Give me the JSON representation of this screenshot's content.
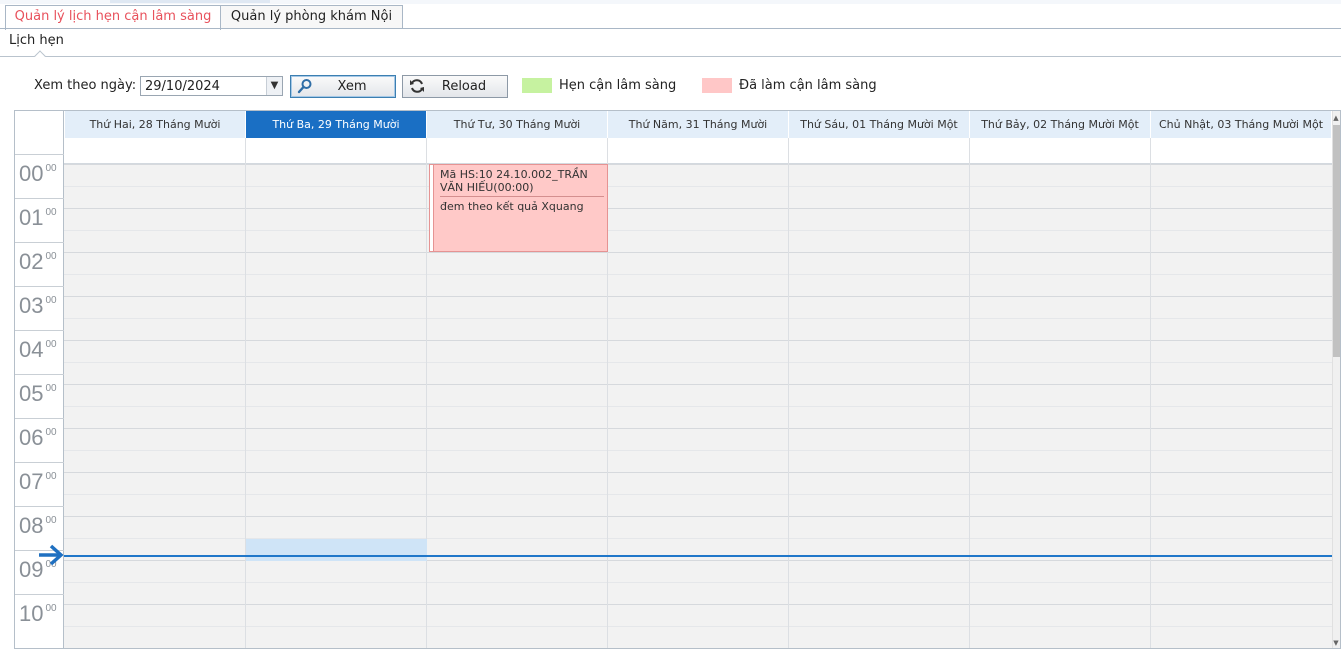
{
  "tabs": [
    {
      "label": "Quản lý lịch hẹn cận lâm sàng",
      "active": true
    },
    {
      "label": "Quản lý phòng khám Nội",
      "active": false
    }
  ],
  "subtab": {
    "label": "Lịch hẹn"
  },
  "toolbar": {
    "date_label": "Xem theo ngày:",
    "date_value": "29/10/2024",
    "view_button": "Xem",
    "reload_button": "Reload"
  },
  "legend": [
    {
      "label": "Hẹn cận lâm sàng",
      "color": "#c6f2a0"
    },
    {
      "label": "Đã làm cận lâm sàng",
      "color": "#ffc7c7"
    }
  ],
  "calendar": {
    "days": [
      {
        "label": "Thứ Hai, 28 Tháng Mười",
        "today": false
      },
      {
        "label": "Thứ Ba, 29 Tháng Mười",
        "today": true
      },
      {
        "label": "Thứ Tư, 30 Tháng Mười",
        "today": false
      },
      {
        "label": "Thứ Năm, 31 Tháng Mười",
        "today": false
      },
      {
        "label": "Thứ Sáu, 01 Tháng Mười Một",
        "today": false
      },
      {
        "label": "Thứ Bảy, 02 Tháng Mười Một",
        "today": false
      },
      {
        "label": "Chủ Nhật, 03 Tháng Mười Một",
        "today": false
      }
    ],
    "hours": [
      "00",
      "01",
      "02",
      "03",
      "04",
      "05",
      "06",
      "07",
      "08",
      "09",
      "10"
    ],
    "minutes_label": "00",
    "appointment": {
      "title": "Mã HS:10 24.10.002_TRẦN VĂN HIẾU(00:00)",
      "description": "đem theo kết quả Xquang",
      "color": "#ffc9c8"
    },
    "today_color": "#1a6fc4",
    "now_line_color": "#2077c9"
  }
}
